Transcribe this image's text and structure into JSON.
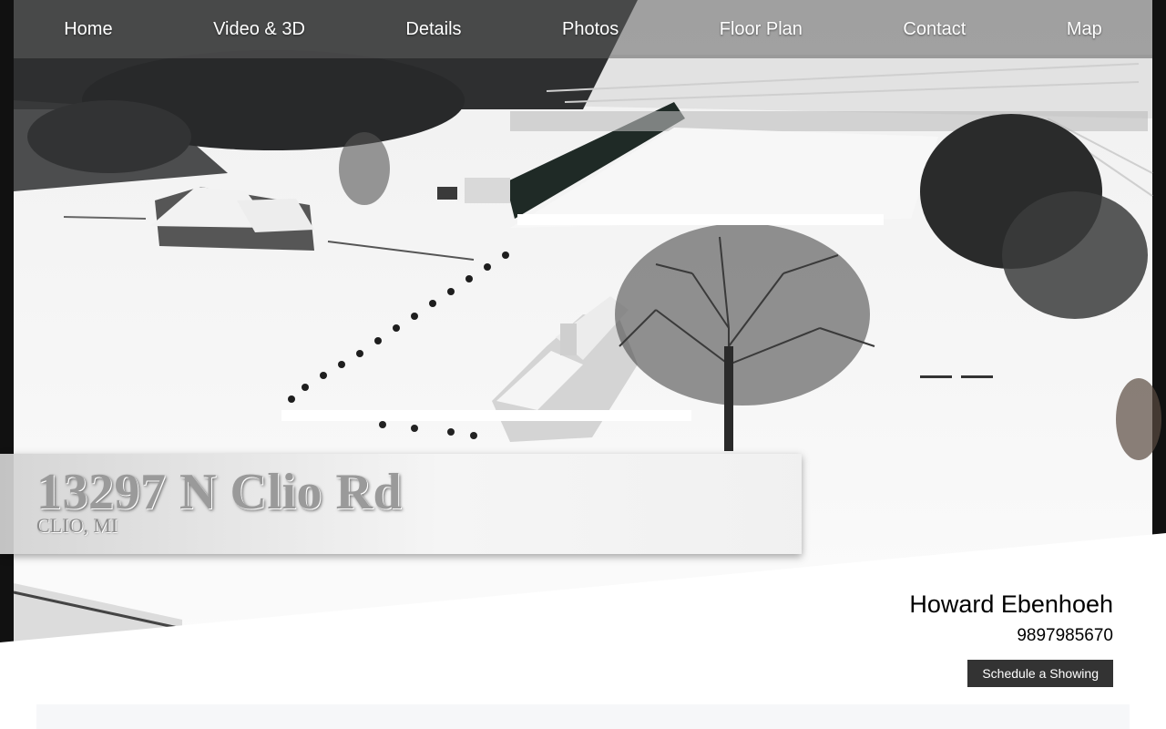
{
  "nav": {
    "items": [
      {
        "label": "Home"
      },
      {
        "label": "Video & 3D"
      },
      {
        "label": "Details"
      },
      {
        "label": "Photos"
      },
      {
        "label": "Floor Plan"
      },
      {
        "label": "Contact"
      },
      {
        "label": "Map"
      }
    ]
  },
  "property": {
    "address": "13297 N Clio Rd",
    "city": "CLIO, MI"
  },
  "agent": {
    "name": "Howard Ebenhoeh",
    "phone": "9897985670",
    "cta_label": "Schedule a Showing"
  }
}
